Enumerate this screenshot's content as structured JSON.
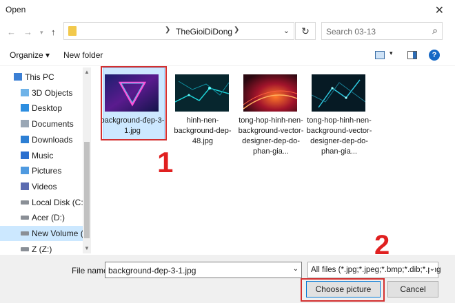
{
  "window": {
    "title": "Open"
  },
  "address": {
    "path": "TheGioiDiDong"
  },
  "search": {
    "placeholder": "Search 03-13"
  },
  "toolbar": {
    "organize_label": "Organize ▾",
    "new_folder_label": "New folder"
  },
  "sidebar": {
    "items": [
      {
        "label": "This PC",
        "icon": "computer-icon"
      },
      {
        "label": "3D Objects",
        "icon": "cube-icon"
      },
      {
        "label": "Desktop",
        "icon": "desktop-icon"
      },
      {
        "label": "Documents",
        "icon": "documents-icon"
      },
      {
        "label": "Downloads",
        "icon": "download-icon"
      },
      {
        "label": "Music",
        "icon": "music-icon"
      },
      {
        "label": "Pictures",
        "icon": "pictures-icon"
      },
      {
        "label": "Videos",
        "icon": "videos-icon"
      },
      {
        "label": "Local Disk (C:)",
        "icon": "drive-icon"
      },
      {
        "label": "Acer (D:)",
        "icon": "drive-icon"
      },
      {
        "label": "New Volume (E:)",
        "icon": "drive-icon",
        "selected": true
      },
      {
        "label": "Z (Z:)",
        "icon": "drive-icon"
      }
    ]
  },
  "files": [
    {
      "name": "background-đẹp-3-1.jpg",
      "selected": true
    },
    {
      "name": "hinh-nen-background-dep-48.jpg"
    },
    {
      "name": "tong-hop-hinh-nen-background-vector-designer-dep-do-phan-gia..."
    },
    {
      "name": "tong-hop-hinh-nen-background-vector-designer-dep-do-phan-gia..."
    }
  ],
  "annotations": {
    "step1": "1",
    "step2": "2",
    "color": "#e02020"
  },
  "bottom": {
    "file_name_label": "File name:",
    "file_name_value": "background-đẹp-3-1.jpg",
    "file_type_value": "All files (*.jpg;*.jpeg;*.bmp;*.dib;*.png",
    "choose_label": "Choose picture",
    "cancel_label": "Cancel"
  }
}
